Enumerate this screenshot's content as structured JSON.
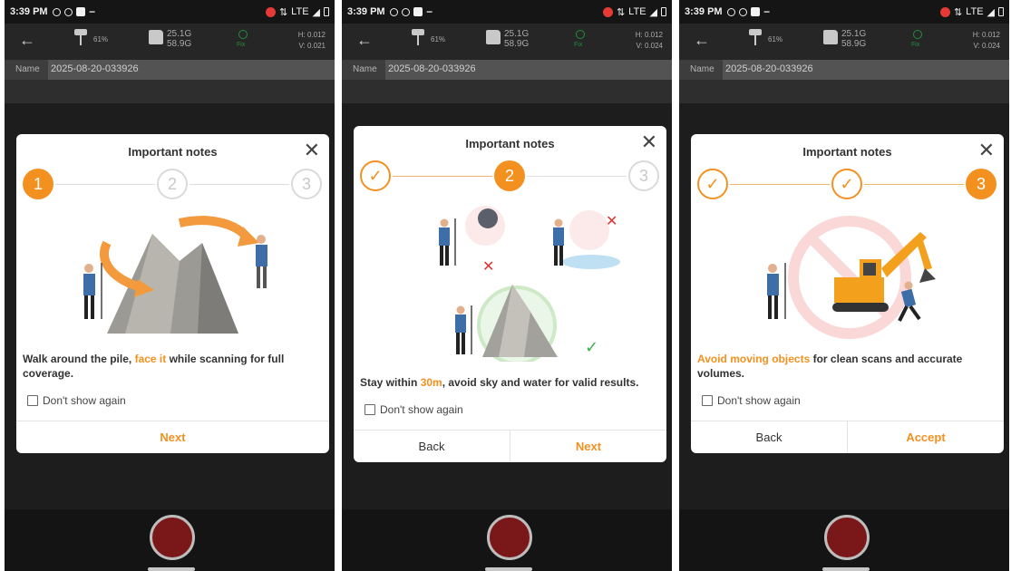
{
  "status": {
    "time": "3:39 PM",
    "network": "LTE"
  },
  "toolbar": {
    "battery": "61%",
    "storage_used": "25.1G",
    "storage_total": "58.9G",
    "fix": "Fix"
  },
  "project": {
    "name_label": "Name",
    "name_value": "2025-08-20-033926"
  },
  "dialog": {
    "title": "Important notes",
    "dont_show": "Don't show again"
  },
  "panels": [
    {
      "h": "H: 0.012",
      "v": "V: 0.021",
      "steps": [
        "1",
        "2",
        "3"
      ],
      "desc_pre": "Walk around the pile, ",
      "desc_hl": "face it",
      "desc_post": " while scanning for full coverage.",
      "next": "Next"
    },
    {
      "h": "H: 0.012",
      "v": "V: 0.024",
      "steps": [
        "✓",
        "2",
        "3"
      ],
      "desc_pre": "Stay within ",
      "desc_hl": "30m",
      "desc_post": ", avoid sky and water for valid results.",
      "back": "Back",
      "next": "Next"
    },
    {
      "h": "H: 0.012",
      "v": "V: 0.024",
      "steps": [
        "✓",
        "✓",
        "3"
      ],
      "desc_pre": "",
      "desc_hl": "Avoid moving objects",
      "desc_post": " for clean scans and accurate volumes.",
      "back": "Back",
      "accept": "Accept"
    }
  ],
  "colors": {
    "accent": "#f39120",
    "fix_green": "#1f8f3c",
    "record_red": "#7a1718"
  }
}
